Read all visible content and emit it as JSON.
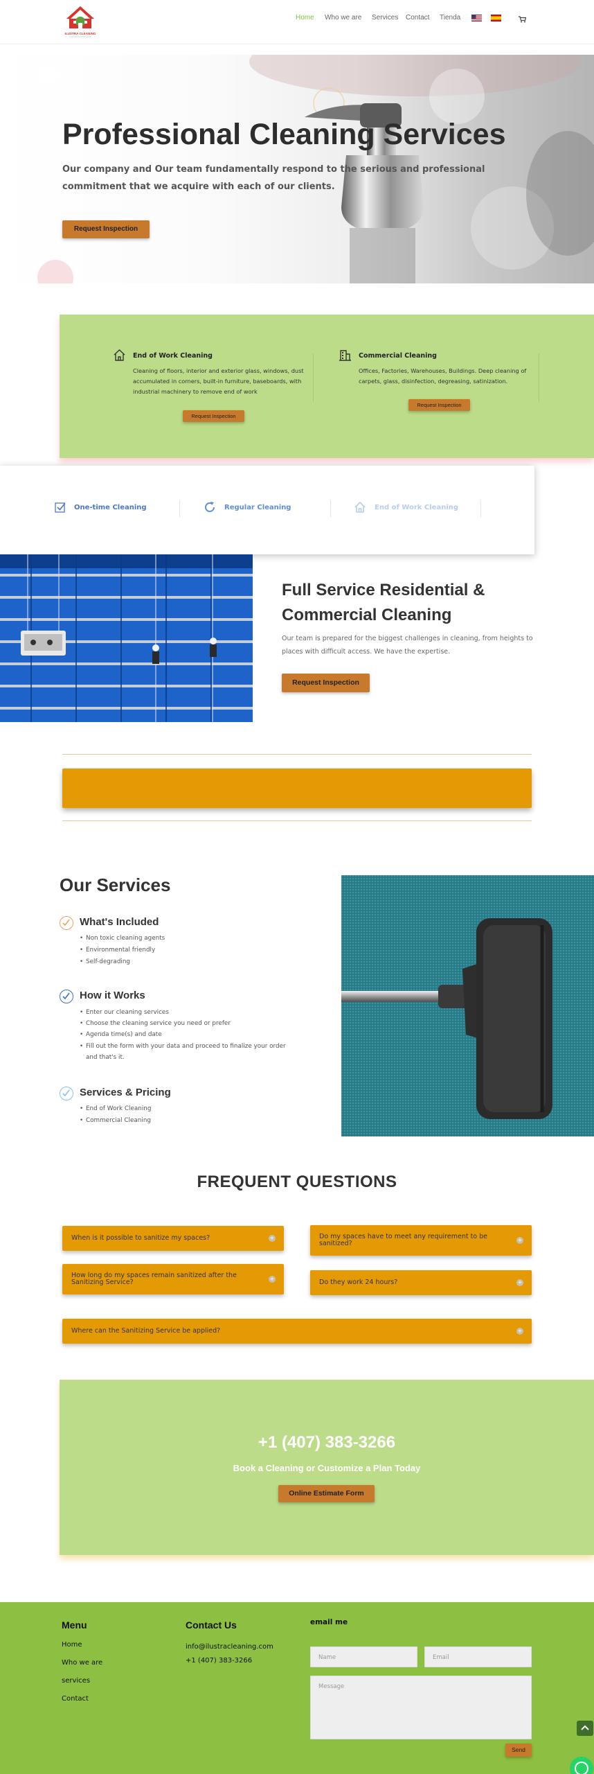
{
  "header": {
    "logo_text": "ILUSTRA CLEANING",
    "nav": [
      "Home",
      "Who we are",
      "Services",
      "Contact",
      "Tienda"
    ],
    "active_nav": "Home",
    "icons": [
      "us-flag-icon",
      "es-flag-icon",
      "cart-icon"
    ],
    "colors": {
      "active": "#7dc243"
    }
  },
  "hero": {
    "title": "Professional Cleaning Services",
    "subtitle": "Our company and Our team fundamentally respond to the serious and professional commitment that we acquire with each of our clients.",
    "button": "Request Inspection"
  },
  "features": {
    "items": [
      {
        "icon": "house-icon",
        "title": "End of Work Cleaning",
        "text": "Cleaning of floors, interior and exterior glass, windows, dust accumulated in corners, built-in furniture, baseboards, with industrial machinery to remove end of work",
        "button": "Request Inspection"
      },
      {
        "icon": "building-icon",
        "title": "Commercial Cleaning",
        "text": "Offices, Factories, Warehouses,  Buildings. Deep cleaning of carpets, glass, disinfection, degreasing,  satinization.",
        "button": "Request Inspection"
      }
    ],
    "colors": {
      "background": "#bcdc8a"
    }
  },
  "tabs": [
    {
      "label": "One-time Cleaning",
      "icon": "checkbox-icon",
      "color": "#4a78c8"
    },
    {
      "label": "Regular Cleaning",
      "icon": "refresh-icon",
      "color": "#5d8fd6"
    },
    {
      "label": "End of Work Cleaning",
      "icon": "house-icon",
      "color": "#b7cdec"
    }
  ],
  "full_service": {
    "title": "Full Service Residential & Commercial Cleaning",
    "text": "Our team is prepared for the biggest challenges in cleaning, from heights to places with difficult access. We have the expertise.",
    "button": "Request Inspection"
  },
  "services": {
    "title": "Our Services",
    "groups": [
      {
        "heading": "What's Included",
        "icon": "check-circle-icon",
        "icon_color": "#e8a55c",
        "items": [
          "Non toxic cleaning agents",
          "Environmental friendly",
          "Self-degrading"
        ]
      },
      {
        "heading": "How it Works",
        "icon": "check-circle-icon",
        "icon_color": "#3d6fcf",
        "items": [
          "Enter our cleaning services",
          "Choose the cleaning service you need or prefer",
          "Agenda time(s) and date",
          "Fill out the form with your data and proceed to finalize your order",
          "and that's it."
        ]
      },
      {
        "heading": "Services & Pricing",
        "icon": "check-circle-icon",
        "icon_color": "#8fbfe6",
        "items": [
          "End of Work Cleaning",
          "Commercial Cleaning"
        ]
      }
    ]
  },
  "faq": {
    "title": "FREQUENT QUESTIONS",
    "questions": [
      "When is it possible to sanitize my spaces?",
      "Do my spaces have to meet any requirement to be sanitized?",
      "How long do my spaces remain sanitized after the Sanitizing Service?",
      "Do they work 24 hours?",
      "Where can the Sanitizing Service be applied?"
    ],
    "colors": {
      "item": "#e49a05"
    }
  },
  "cta": {
    "phone": "+1 (407) 383-3266",
    "subtitle": "Book a Cleaning or Customize a Plan Today",
    "button": "Online Estimate Form"
  },
  "footer": {
    "menu_title": "Menu",
    "menu": [
      "Home",
      "Who we are",
      "services",
      "Contact"
    ],
    "contact_title": "Contact Us",
    "email": "info@ilustracleaning.com",
    "phone": "+1 (407) 383-3266",
    "form_title": "email me",
    "name_placeholder": "Name",
    "email_placeholder": "Email",
    "message_placeholder": "Message",
    "send": "Send",
    "colors": {
      "background": "#8dbf42"
    }
  }
}
